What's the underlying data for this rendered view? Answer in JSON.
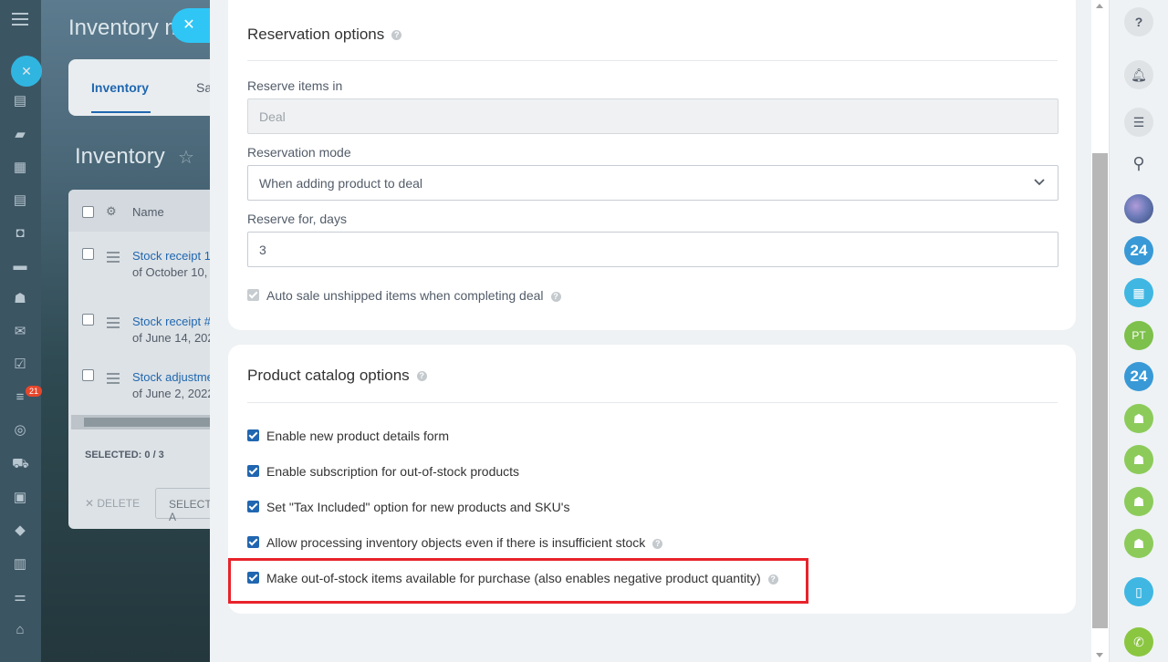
{
  "background": {
    "title": "Inventory m",
    "tabs": [
      "Inventory",
      "Sa"
    ],
    "page_heading": "Inventory",
    "grid_header": "Name",
    "rows": [
      {
        "title": "Stock receipt 1",
        "date": "of October 10,"
      },
      {
        "title": "Stock receipt #",
        "date": "of June 14, 202"
      },
      {
        "title": "Stock adjustme",
        "date": "of June 2, 2022"
      }
    ],
    "selected": "SELECTED: 0 / 3",
    "delete_label": "✕ DELETE",
    "select_label": "SELECT A",
    "counter_badge": "21"
  },
  "panel": {
    "reservation": {
      "title": "Reservation options",
      "reserve_in_label": "Reserve items in",
      "reserve_in_value": "Deal",
      "mode_label": "Reservation mode",
      "mode_value": "When adding product to deal",
      "days_label": "Reserve for, days",
      "days_value": "3",
      "auto_sale_label": "Auto sale unshipped items when completing deal"
    },
    "catalog": {
      "title": "Product catalog options",
      "options": [
        "Enable new product details form",
        "Enable subscription for out-of-stock products",
        "Set \"Tax Included\" option for new products and SKU's",
        "Allow processing inventory objects even if there is insufficient stock",
        "Make out-of-stock items available for purchase (also enables negative product quantity)"
      ]
    }
  },
  "rightbar": {
    "help": "?",
    "b24_1": "24",
    "b24_2": "24",
    "pt": "PT"
  },
  "colors": {
    "accent": "#2066b0",
    "close_button": "#2fc6f6",
    "highlight": "#e8232b"
  }
}
